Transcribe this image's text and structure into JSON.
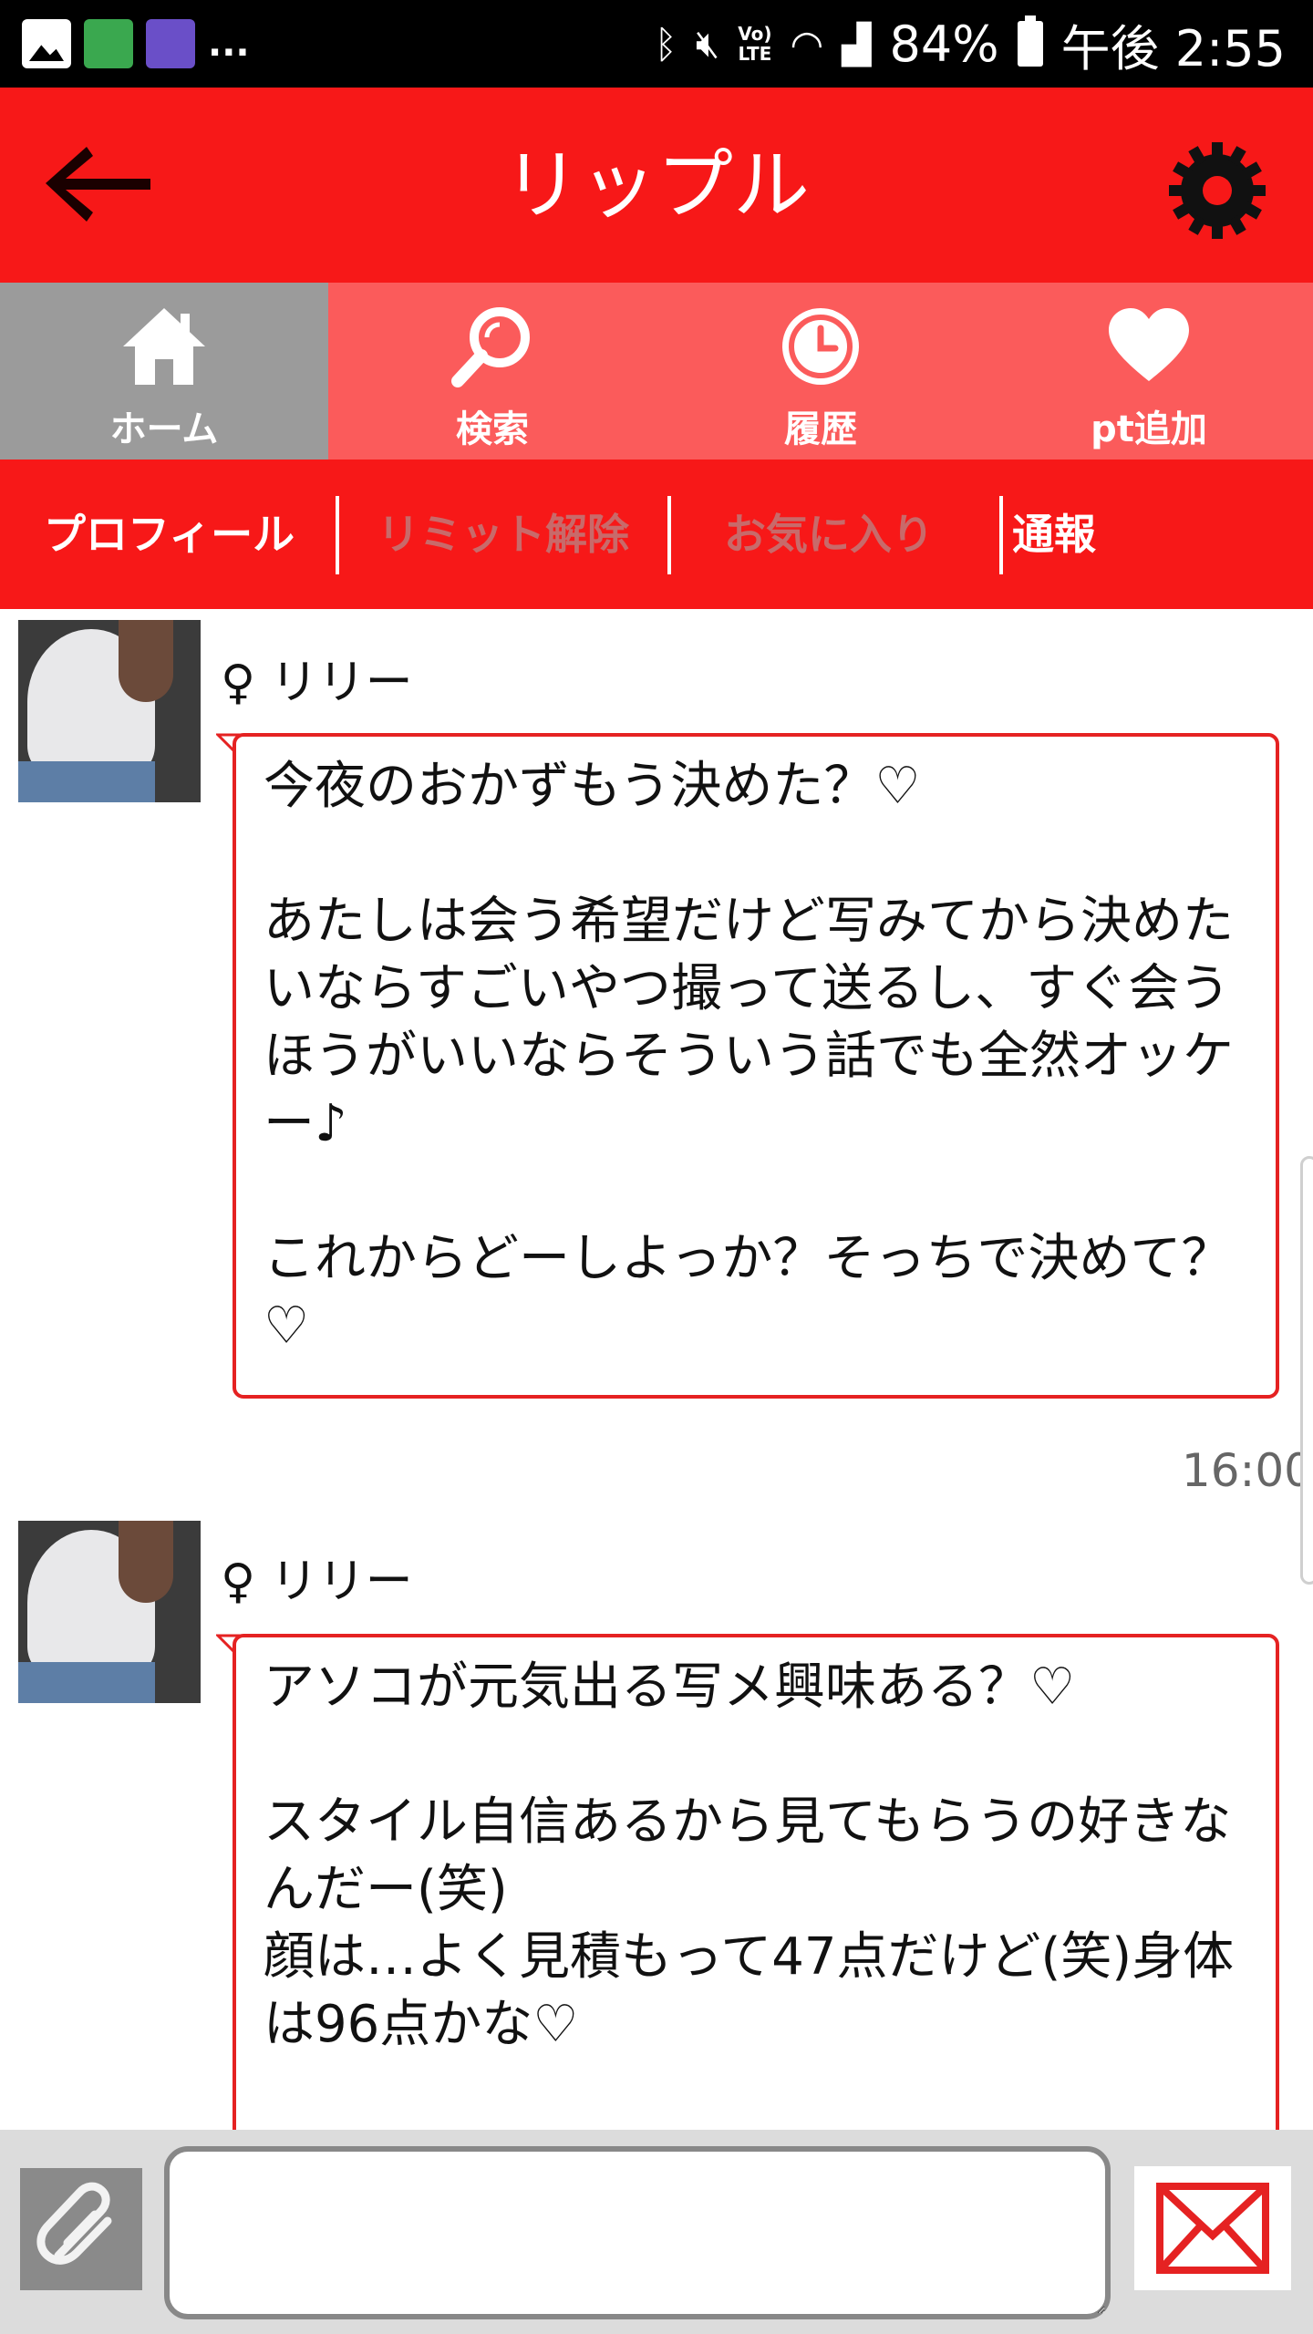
{
  "status_bar": {
    "left_icons": [
      "gallery-icon",
      "app-notification-icon",
      "app-notification-icon"
    ],
    "overflow": "...",
    "lte": "Vo)\nLTE",
    "battery": "84%",
    "time": "午後 2:55"
  },
  "app_bar": {
    "title": "リップル",
    "back_icon": "arrow-left-icon",
    "settings_icon": "gear-icon"
  },
  "tabs": [
    {
      "label": "ホーム",
      "icon": "home-icon",
      "active": true
    },
    {
      "label": "検索",
      "icon": "search-icon",
      "active": false
    },
    {
      "label": "履歴",
      "icon": "clock-icon",
      "active": false
    },
    {
      "label": "pt追加",
      "icon": "heart-icon",
      "active": false
    }
  ],
  "sub_nav": [
    {
      "label": "プロフィール",
      "enabled": true
    },
    {
      "label": "リミット解除",
      "enabled": false
    },
    {
      "label": "お気に入り",
      "enabled": false
    },
    {
      "label": "通報",
      "enabled": true
    }
  ],
  "messages": [
    {
      "sender": "♀ リリー",
      "text": "今夜のおかずもう決めた？♡\n\nあたしは会う希望だけど写みてから決めたいならすごいやつ撮って送るし、すぐ会うほうがいいならそういう話でも全然オッケー♪\n\nこれからどーしよっか？そっちで決めて？♡",
      "time": "16:00"
    },
    {
      "sender": "♀ リリー",
      "text": "アソコが元気出る写メ興味ある？♡\n\nスタイル自信あるから見てもらうの好きなんだー(笑)\n顔は…よく見積もって47点だけど(笑)身体は96点かな♡",
      "time": ""
    }
  ],
  "input": {
    "value": "",
    "placeholder": "",
    "attach_icon": "paperclip-icon",
    "send_icon": "envelope-icon"
  },
  "colors": {
    "brand_red": "#f71818",
    "tab_inactive": "#fb5b5b",
    "tab_active": "#9b9b9b",
    "bubble_border": "#e52222"
  }
}
